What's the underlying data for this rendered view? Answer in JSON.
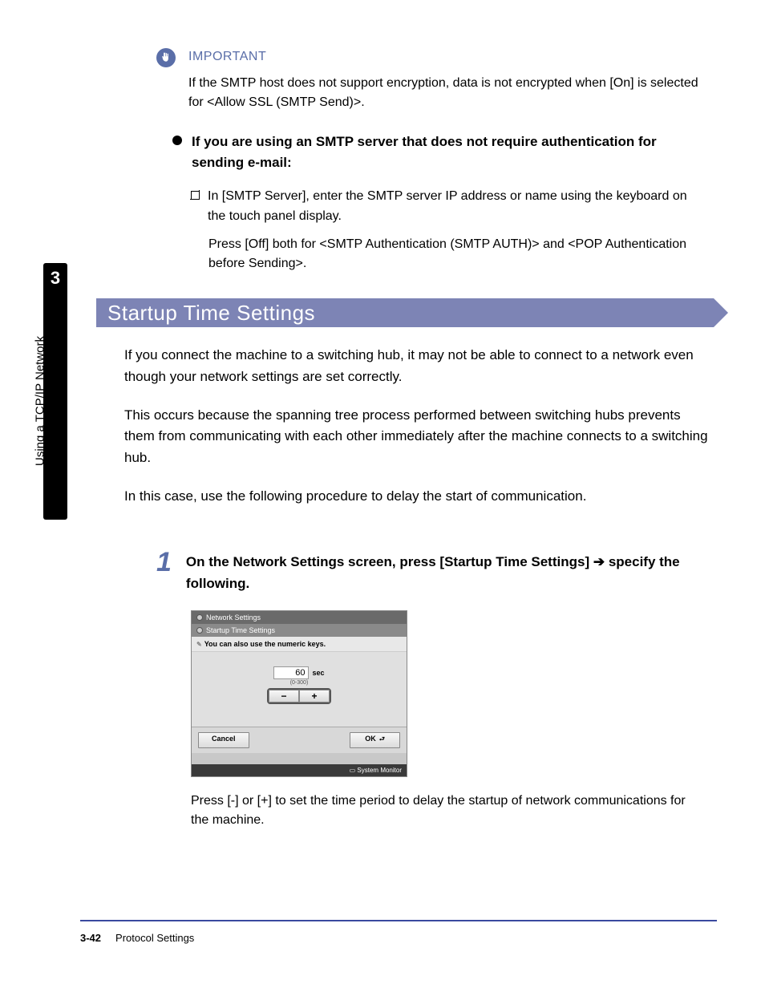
{
  "sidebar": {
    "chapter": "3",
    "label": "Using a TCP/IP Network"
  },
  "important": {
    "label": "IMPORTANT",
    "body": "If the SMTP host does not support encryption, data is not encrypted when [On] is selected for <Allow SSL (SMTP Send)>."
  },
  "bullet": {
    "heading": "If you are using an SMTP server that does not require authentication for sending e-mail:",
    "sub1": "In [SMTP Server], enter the SMTP server IP address or name using the keyboard on the touch panel display.",
    "sub2": "Press [Off] both for <SMTP Authentication (SMTP AUTH)> and <POP Authentication before Sending>."
  },
  "section": {
    "title": "Startup Time Settings",
    "p1": "If you connect the machine to a switching hub, it may not be able to connect to a network even though your network settings are set correctly.",
    "p2": "This occurs because the spanning tree process performed between switching hubs prevents them from communicating with each other immediately after the machine connects to a switching hub.",
    "p3": "In this case, use the following procedure to delay the start of communication."
  },
  "step": {
    "num": "1",
    "text_a": "On the Network Settings screen, press [Startup Time Settings] ",
    "text_b": " specify the following."
  },
  "device": {
    "bar1": "Network Settings",
    "bar2": "Startup Time Settings",
    "hint": "You can also use the numeric keys.",
    "value": "60",
    "unit": "sec",
    "range": "(0-300)",
    "minus": "−",
    "plus": "+",
    "cancel": "Cancel",
    "ok": "OK",
    "sysmon": "System Monitor"
  },
  "caption": "Press [-] or [+] to set the time period to delay the startup of network communications for the machine.",
  "footer": {
    "page": "3-42",
    "section": "Protocol Settings"
  }
}
